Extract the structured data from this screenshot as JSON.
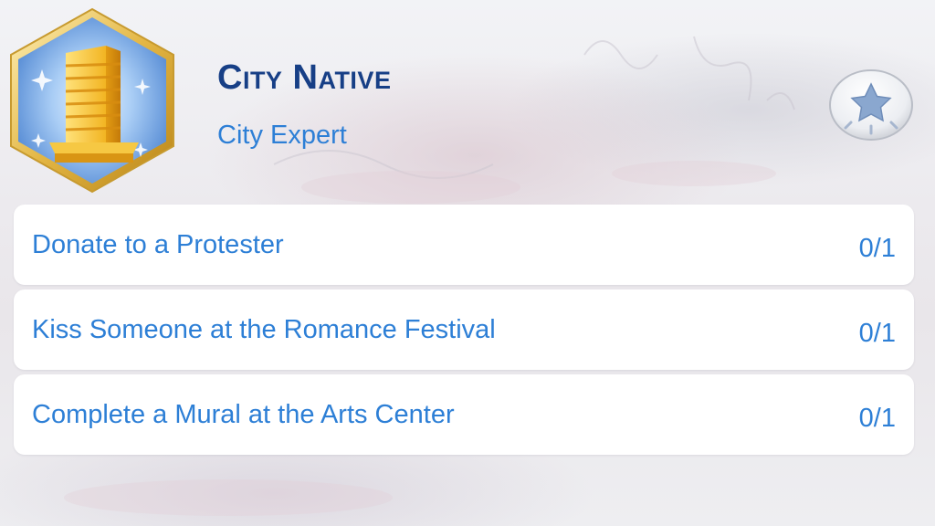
{
  "aspiration": {
    "title": "City Native",
    "subtitle": "City Expert",
    "badge_icon": "skyscraper-icon",
    "action_icon": "star-icon"
  },
  "goals": [
    {
      "label": "Donate to a Protester",
      "progress": "0/1"
    },
    {
      "label": "Kiss Someone at the Romance Festival",
      "progress": "0/1"
    },
    {
      "label": "Complete a Mural at the Arts Center",
      "progress": "0/1"
    }
  ],
  "colors": {
    "title": "#173f86",
    "text": "#2d7fd6",
    "badge_border": "#e9c46a",
    "badge_fill": "#9fc5f2",
    "row_background": "#ffffff"
  }
}
